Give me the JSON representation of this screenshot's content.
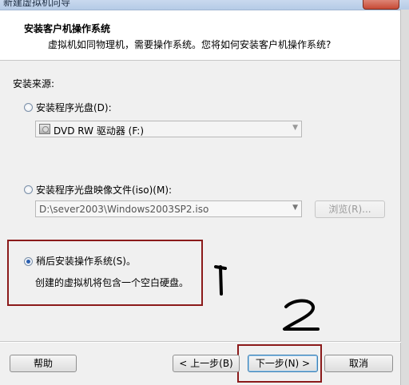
{
  "window": {
    "title": "新建虚拟机向导"
  },
  "header": {
    "title": "安装客户机操作系统",
    "subtitle": "虚拟机如同物理机，需要操作系统。您将如何安装客户机操作系统?"
  },
  "source_label": "安装来源:",
  "options": {
    "disc": {
      "label": "安装程序光盘(D):",
      "drive": "DVD RW 驱动器 (F:)",
      "selected": false
    },
    "iso": {
      "label": "安装程序光盘映像文件(iso)(M):",
      "path": "D:\\sever2003\\Windows2003SP2.iso",
      "browse": "浏览(R)...",
      "selected": false
    },
    "later": {
      "label": "稍后安装操作系统(S)。",
      "description": "创建的虚拟机将包含一个空白硬盘。",
      "selected": true
    }
  },
  "annotations": {
    "one": "1",
    "two": "2"
  },
  "buttons": {
    "help": "帮助",
    "back": "< 上一步(B)",
    "next": "下一步(N) >",
    "cancel": "取消"
  },
  "colors": {
    "annotation_red": "#8b1a1a",
    "accent": "#2a5fb0"
  }
}
